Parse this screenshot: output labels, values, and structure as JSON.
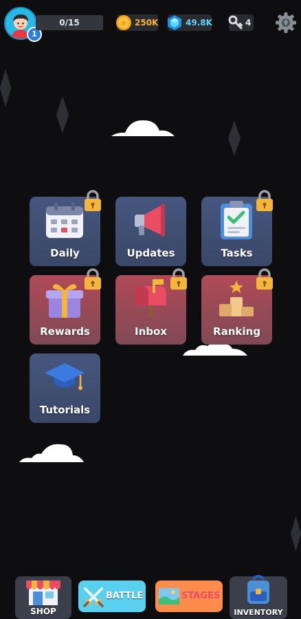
{
  "player": {
    "level": "1",
    "xp": "0/15"
  },
  "resources": {
    "coins": "250K",
    "gems": "49.8K",
    "keys": "4"
  },
  "tiles": {
    "daily": "Daily",
    "updates": "Updates",
    "tasks": "Tasks",
    "rewards": "Rewards",
    "inbox": "Inbox",
    "ranking": "Ranking",
    "tutorials": "Tutorials"
  },
  "nav": {
    "shop": "SHOP",
    "battle": "BATTLE",
    "stages": "STAGES",
    "inventory": "INVENTORY"
  },
  "icons": {
    "gear": "gear-icon",
    "coin": "coin-icon",
    "gem": "gem-icon",
    "key": "key-icon",
    "lock": "lock-icon"
  },
  "colors": {
    "background": "#0e0e10",
    "tile_blue": "#46567e",
    "tile_red": "#b04a57",
    "coin": "#ffb23e",
    "gem": "#5fd4ff",
    "battle": "#5ad0f0",
    "stages": "#ff8c4a"
  }
}
